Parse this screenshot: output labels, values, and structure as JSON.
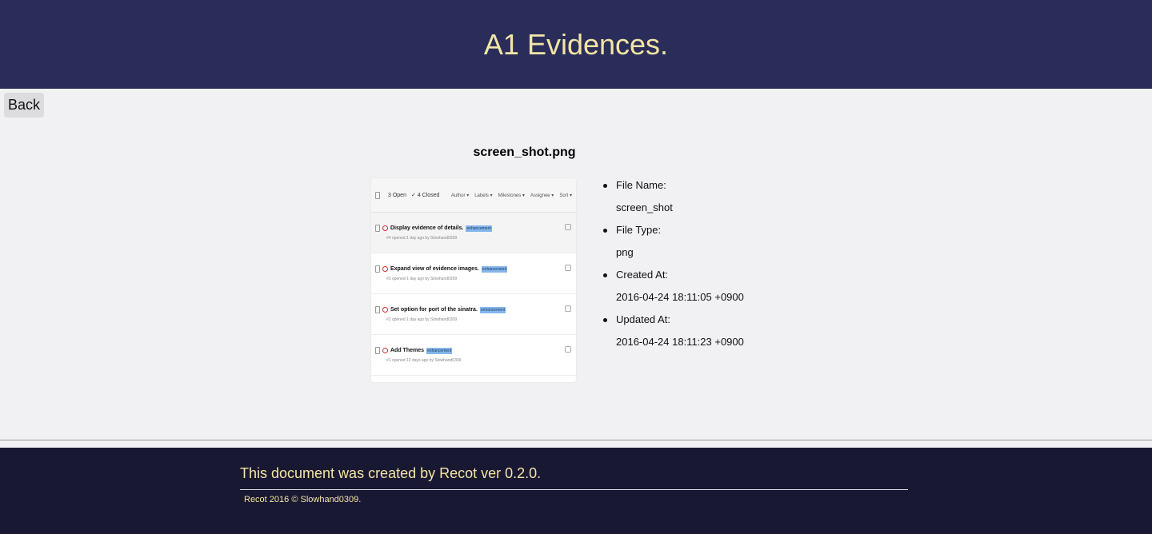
{
  "header": {
    "title": "A1 Evidences."
  },
  "nav": {
    "back_label": "Back"
  },
  "evidence": {
    "file_title": "screen_shot.png",
    "thumbnail": {
      "open_label": "3 Open",
      "closed_label": "✓ 4 Closed",
      "filters": [
        "Author ▾",
        "Labels ▾",
        "Milestones ▾",
        "Assignee ▾",
        "Sort ▾"
      ],
      "issues": [
        {
          "title": "Display evidence of details.",
          "tag": "enhancement",
          "meta": "#4 opened 1 day ago by Slowhand0309"
        },
        {
          "title": "Expand view of evidence images.",
          "tag": "enhancement",
          "meta": "#3 opened 1 day ago by Slowhand0309"
        },
        {
          "title": "Set option for port of the sinatra.",
          "tag": "enhancement",
          "meta": "#2 opened 1 day ago by Slowhand0309"
        },
        {
          "title": "Add Themes",
          "tag": "enhancement",
          "meta": "#1 opened 12 days ago by Slowhand0309"
        }
      ]
    },
    "details": {
      "file_name_label": "File Name:",
      "file_name": "screen_shot",
      "file_type_label": "File Type:",
      "file_type": "png",
      "created_label": "Created At:",
      "created": "2016-04-24 18:11:05 +0900",
      "updated_label": "Updated At:",
      "updated": "2016-04-24 18:11:23 +0900"
    }
  },
  "footer": {
    "credit": "This document was created by Recot ver 0.2.0.",
    "copyright": "Recot 2016 © Slowhand0309."
  },
  "colors": {
    "header_bg": "#2a2d5a",
    "footer_bg": "#191833",
    "accent_text": "#f3e5a4",
    "page_bg": "#f1f1f4",
    "label_tag": "#84b6eb"
  }
}
